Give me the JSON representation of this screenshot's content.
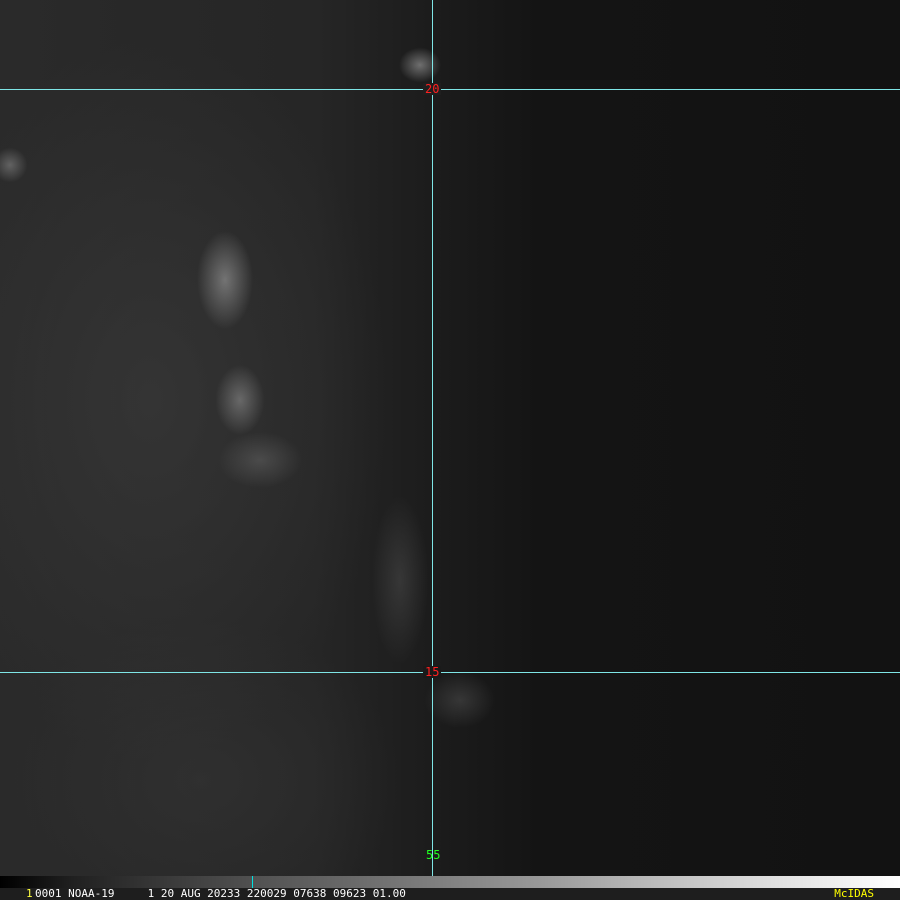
{
  "map": {
    "grid_labels": {
      "lat_top": "20",
      "lat_bottom": "15",
      "lon": "55"
    },
    "colors": {
      "grid": "#7fe6e6",
      "lat_label": "#ff2020",
      "lon_label": "#20ff20"
    }
  },
  "status_bar": {
    "frame": "1",
    "text": "0001 NOAA-19     1 20 AUG 20233 220029 07638 09623 01.00",
    "brand": "McIDAS"
  }
}
